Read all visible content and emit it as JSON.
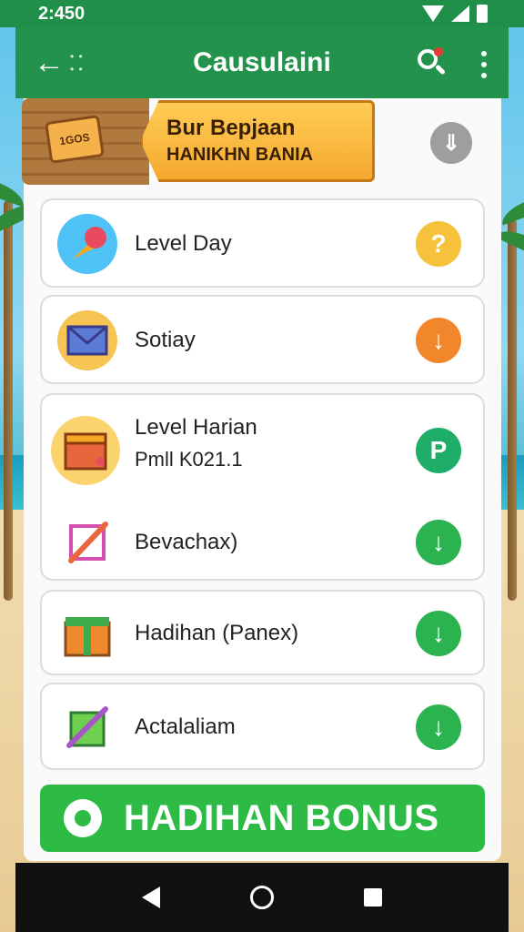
{
  "status": {
    "time": "2:450"
  },
  "appbar": {
    "title": "Causulaini",
    "back_dots": "• • • •"
  },
  "banner": {
    "ticket_text": "1GOS",
    "line1": "Bur Bepjaan",
    "line2": "HANIKHN BANIA"
  },
  "items": [
    {
      "label": "Level Day",
      "action": "?",
      "color": "#f7c23b",
      "icon": "ice-cream-icon"
    },
    {
      "label": "Sotiay",
      "action": "↓",
      "color": "#f1862a",
      "icon": "envelope-icon"
    },
    {
      "label": "Level Harian",
      "sublabel": "Pmll K021.1",
      "action": "P",
      "color": "#1fae6a",
      "icon": "treasure-box-icon"
    },
    {
      "label": "Bevachax)",
      "action": "↓",
      "color": "#2ab34f",
      "icon": "pencil-square-icon"
    },
    {
      "label": "Hadihan (Panex)",
      "action": "↓",
      "color": "#2ab34f",
      "icon": "gift-box-icon"
    },
    {
      "label": "Actalaliam",
      "action": "↓",
      "color": "#2ab34f",
      "icon": "wand-square-icon"
    }
  ],
  "bonus_button": {
    "label": "HADIHAN BONUS"
  },
  "collapse_symbol": "⇓"
}
